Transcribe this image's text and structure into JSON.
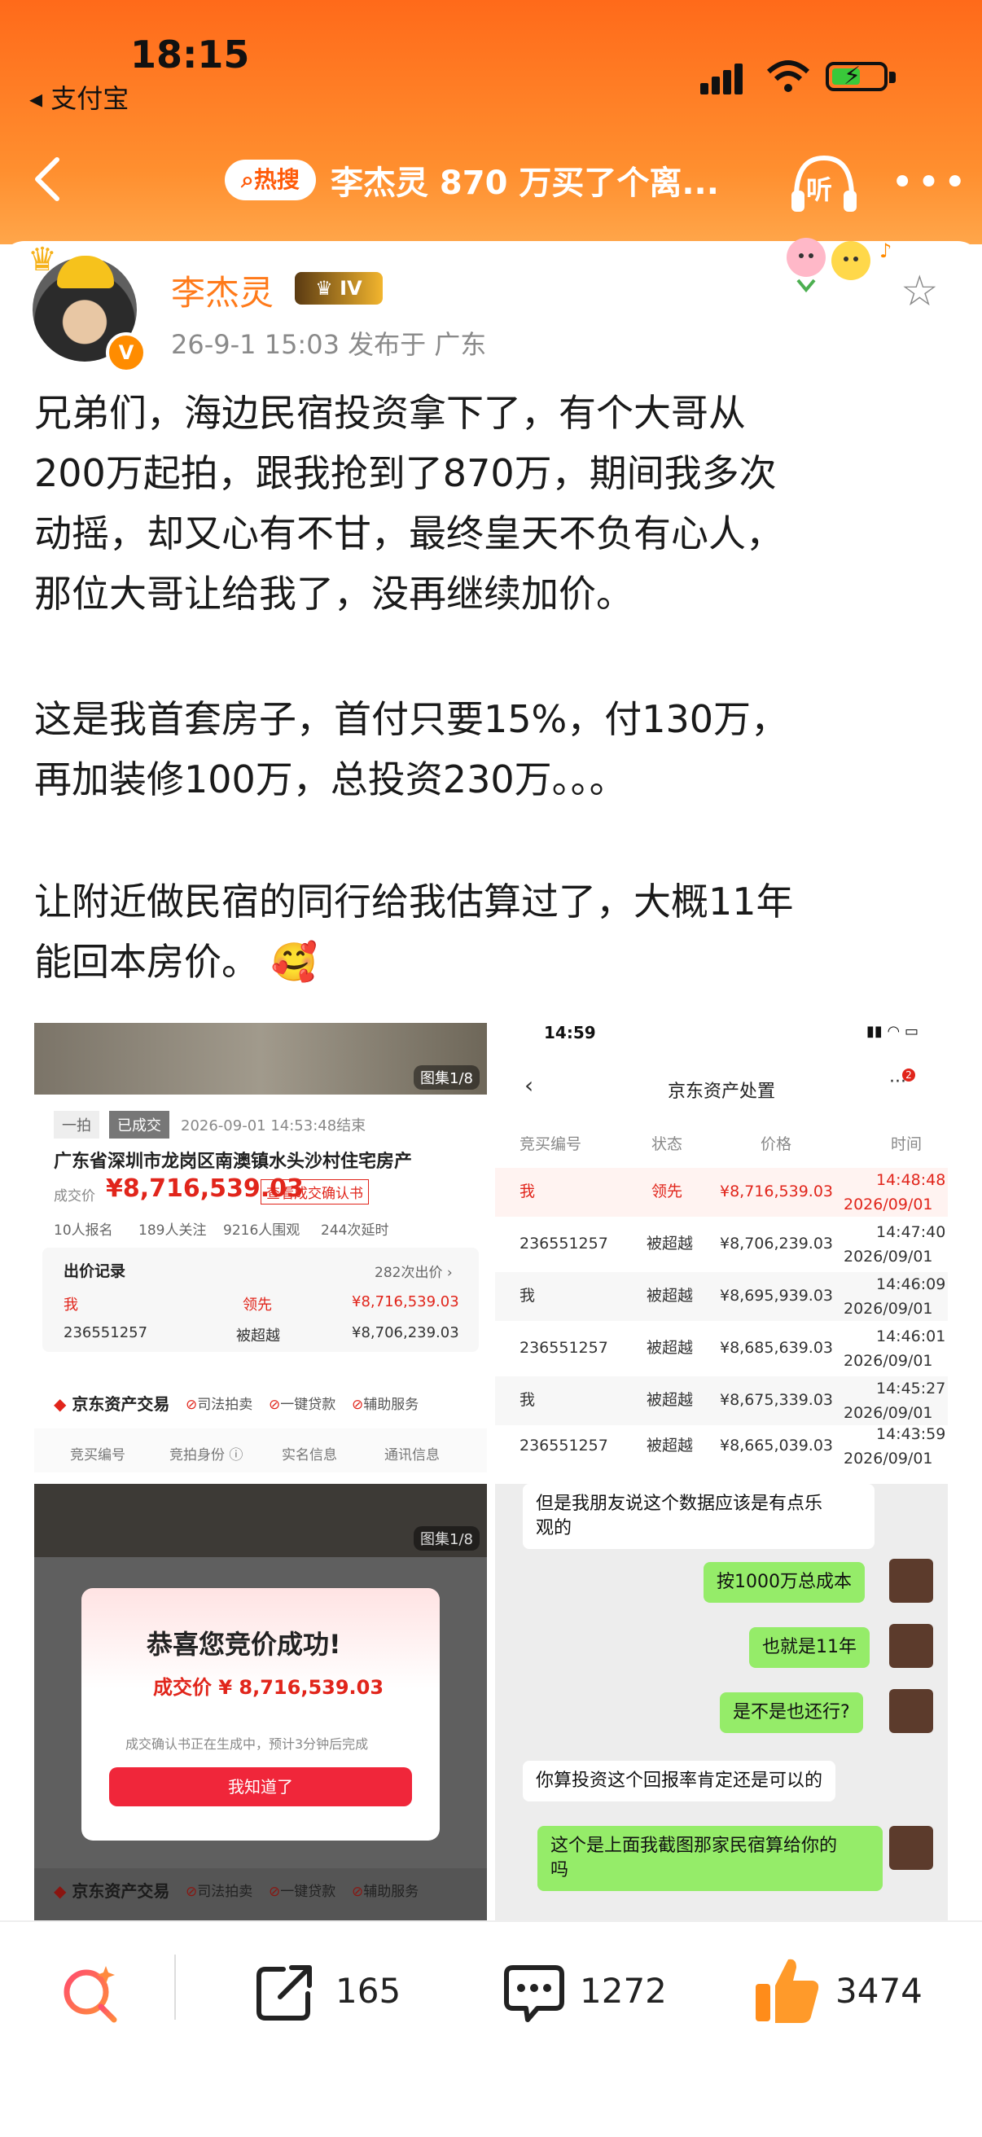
{
  "status": {
    "time": "18:15",
    "back_app": "◂ 支付宝"
  },
  "nav": {
    "hot": "热搜",
    "title": "李杰灵 870 万买了个离...",
    "listen": "听",
    "more": "•••"
  },
  "post": {
    "author": "李杰灵",
    "level": "IV",
    "badge": "V",
    "meta": "26-9-1 15:03  发布于 广东",
    "lines": [
      "兄弟们，海边民宿投资拿下了，有个大哥从",
      "200万起拍，跟我抢到了870万，期间我多次",
      "动摇，却又心有不甘，最终皇天不负有心人，",
      "那位大哥让给我了，没再继续加价。",
      "这是我首套房子，首付只要15%，付130万，",
      "再加装修100万，总投资230万。。。",
      "让附近做民宿的同行给我估算过了，大概11年",
      "能回本房价。"
    ],
    "emoji": "🥰"
  },
  "shot1": {
    "gallery": "图集1/8",
    "tag1": "一拍",
    "tag2": "已成交",
    "ended": "2026-09-01 14:53:48结束",
    "heading": "广东省深圳市龙岗区南澳镇水头沙村住宅房产",
    "price_label": "成交价",
    "price": "¥8,716,539.03",
    "confirm": "查看成交确认书",
    "stats": [
      "10人报名",
      "189人关注",
      "9216人围观",
      "244次延时"
    ],
    "bid_title": "出价记录",
    "bid_count": "282次出价 ›",
    "bids": [
      {
        "who": "我",
        "status": "领先",
        "price": "¥8,716,539.03"
      },
      {
        "who": "236551257",
        "status": "被超越",
        "price": "¥8,706,239.03"
      }
    ],
    "brand": "京东资产交易",
    "features": [
      "司法拍卖",
      "一键贷款",
      "辅助服务"
    ],
    "tabs": [
      "竞买编号",
      "竞拍身份 ⓘ",
      "实名信息",
      "通讯信息"
    ]
  },
  "shot2": {
    "time": "14:59",
    "title": "京东资产处置",
    "badge": "2",
    "headers": [
      "竞买编号",
      "状态",
      "价格",
      "时间"
    ],
    "rows": [
      {
        "id": "我",
        "status": "领先",
        "price": "¥8,716,539.03",
        "time": "14:48:48",
        "date": "2026/09/01"
      },
      {
        "id": "236551257",
        "status": "被超越",
        "price": "¥8,706,239.03",
        "time": "14:47:40",
        "date": "2026/09/01"
      },
      {
        "id": "我",
        "status": "被超越",
        "price": "¥8,695,939.03",
        "time": "14:46:09",
        "date": "2026/09/01"
      },
      {
        "id": "236551257",
        "status": "被超越",
        "price": "¥8,685,639.03",
        "time": "14:46:01",
        "date": "2026/09/01"
      },
      {
        "id": "我",
        "status": "被超越",
        "price": "¥8,675,339.03",
        "time": "14:45:27",
        "date": "2026/09/01"
      },
      {
        "id": "236551257",
        "status": "被超越",
        "price": "¥8,665,039.03",
        "time": "14:43:59",
        "date": "2026/09/01"
      }
    ]
  },
  "shot3": {
    "gallery": "图集1/8",
    "modal_title": "恭喜您竞价成功!",
    "modal_price": "成交价 ¥ 8,716,539.03",
    "modal_note": "成交确认书正在生成中，预计3分钟后完成",
    "modal_button": "我知道了",
    "brand": "京东资产交易",
    "features": [
      "司法拍卖",
      "一键贷款",
      "辅助服务"
    ]
  },
  "shot4": {
    "top": [
      "但是我朋友说这个数据应该是有点乐",
      "观的"
    ],
    "m1": "按1000万总成本",
    "m2": "也就是11年",
    "m3": "是不是也还行?",
    "r1": "你算投资这个回报率肯定还是可以的",
    "m4a": "这个是上面我截图那家民宿算给你的",
    "m4b": "吗"
  },
  "actions": {
    "share": "165",
    "comment": "1272",
    "like": "3474"
  },
  "colors": {
    "brand_orange": "#ff6a1a",
    "price_red": "#e1251b",
    "chat_green": "#95ec69"
  }
}
